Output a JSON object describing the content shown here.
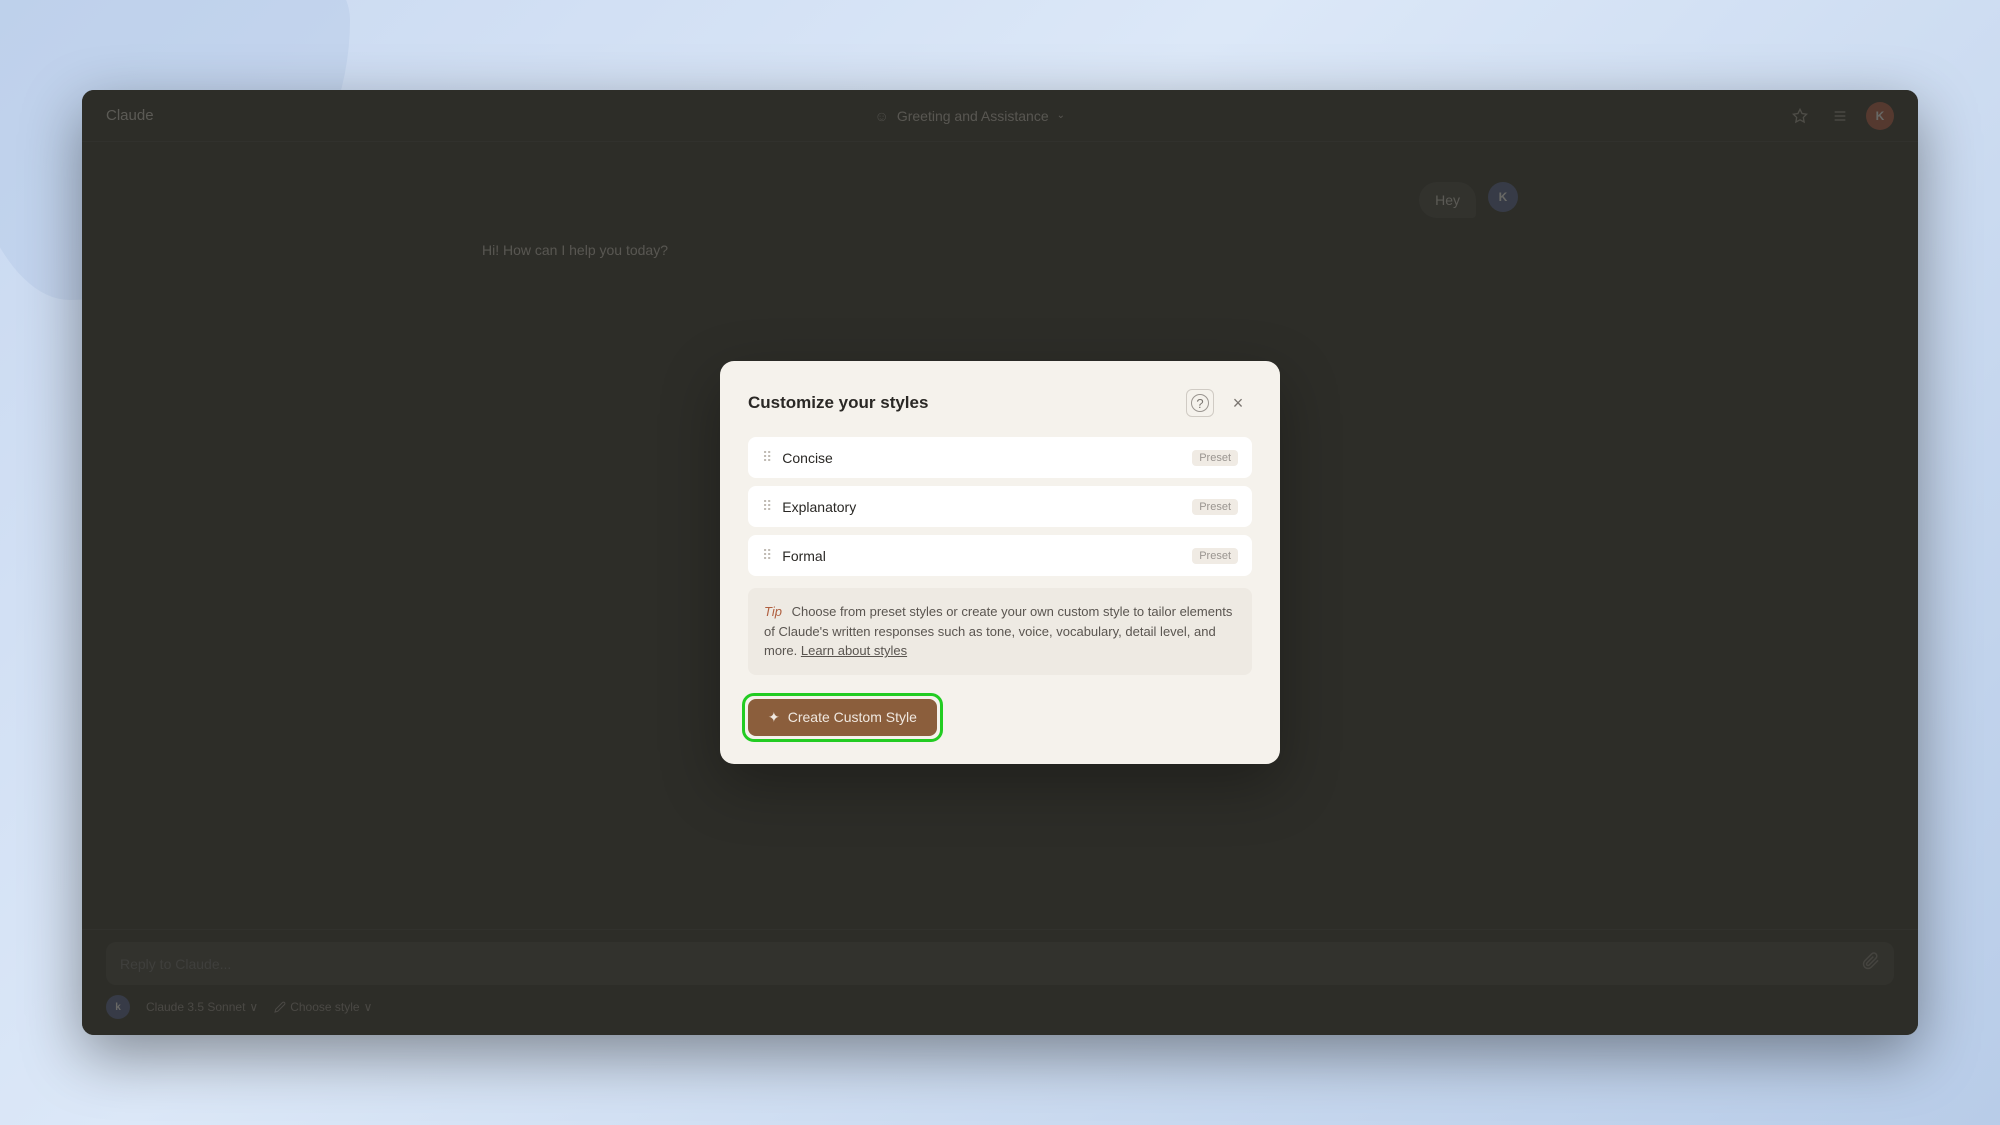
{
  "app": {
    "title": "Claude",
    "window_bg": "#3a3a35"
  },
  "topbar": {
    "title": "Claude",
    "center_icon": "☺",
    "center_label": "Greeting and Assistance",
    "center_chevron": "⌄",
    "star_icon": "★",
    "sliders_icon": "⇄",
    "avatar_initial": "K"
  },
  "chat": {
    "user_avatar": "K",
    "user_message": "Hey",
    "assistant_greeting": "Hi! How can I help you today?"
  },
  "bottom_bar": {
    "reply_placeholder": "Reply to Claude...",
    "user_avatar": "k",
    "model_label": "Claude 3.5 Sonnet",
    "model_chevron": "∨",
    "style_icon": "✎",
    "style_label": "Choose style",
    "style_chevron": "∨"
  },
  "modal": {
    "title": "Customize your styles",
    "help_icon": "?",
    "close_icon": "×",
    "styles": [
      {
        "id": "concise",
        "name": "Concise",
        "badge": "Preset"
      },
      {
        "id": "explanatory",
        "name": "Explanatory",
        "badge": "Preset"
      },
      {
        "id": "formal",
        "name": "Formal",
        "badge": "Preset"
      }
    ],
    "tip": {
      "label": "Tip",
      "text": "Choose from preset styles or create your own custom style to tailor elements of Claude's written responses such as tone, voice, vocabulary, detail level, and more.",
      "link_text": "Learn about styles",
      "link_href": "#"
    },
    "create_button": {
      "icon": "✦",
      "label": "Create Custom Style"
    }
  },
  "colors": {
    "accent_green": "#22cc22",
    "button_brown": "#8B5E3C",
    "preset_badge_bg": "#f0ebe4",
    "modal_bg": "#f5f2ec"
  }
}
